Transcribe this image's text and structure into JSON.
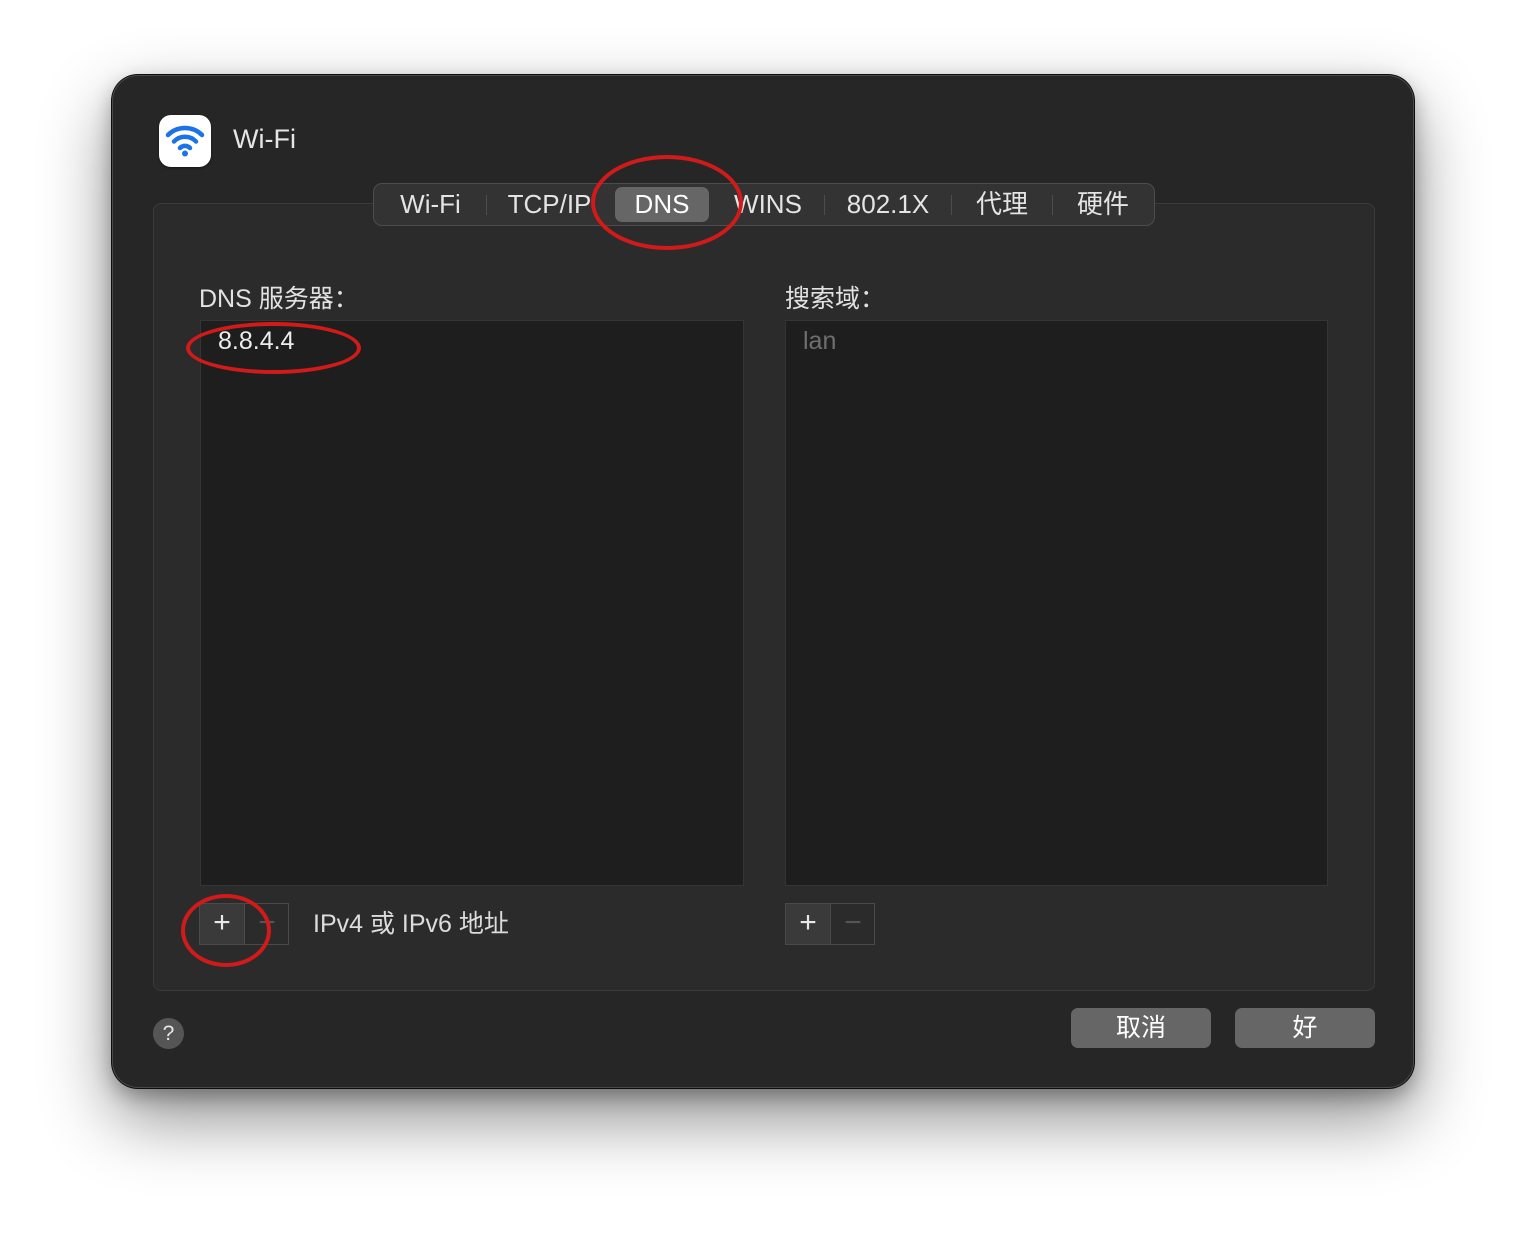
{
  "window": {
    "title": "Wi-Fi",
    "icon": "wifi-icon"
  },
  "tabs": [
    {
      "label": "Wi-Fi",
      "active": false
    },
    {
      "label": "TCP/IP",
      "active": false
    },
    {
      "label": "DNS",
      "active": true
    },
    {
      "label": "WINS",
      "active": false
    },
    {
      "label": "802.1X",
      "active": false
    },
    {
      "label": "代理",
      "active": false
    },
    {
      "label": "硬件",
      "active": false
    }
  ],
  "dns": {
    "label": "DNS 服务器：",
    "servers": [
      "8.8.4.4"
    ],
    "hint": "IPv4 或 IPv6 地址"
  },
  "search": {
    "label": "搜索域：",
    "domains": [
      "lan"
    ]
  },
  "buttons": {
    "plus": "+",
    "minus": "−",
    "help": "?",
    "cancel": "取消",
    "ok": "好"
  },
  "colors": {
    "window_bg": "#262626",
    "annotation": "#d11a1a",
    "wifi_blue": "#1a73e8"
  }
}
